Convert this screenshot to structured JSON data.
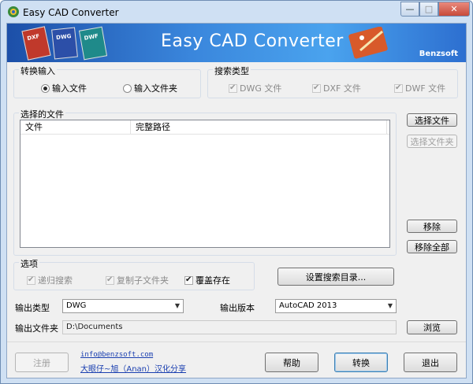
{
  "window": {
    "title": "Easy CAD Converter",
    "minimize": "—",
    "maximize": "□",
    "close": "✕",
    "close_color": "#c74a3a"
  },
  "banner": {
    "title": "Easy CAD Converter",
    "brand": "Benzsoft",
    "file_icons": [
      {
        "label": "DXF",
        "color": "#c0392b"
      },
      {
        "label": "DWG",
        "color": "#2c4fa8"
      },
      {
        "label": "DWF",
        "color": "#1f8a8a"
      }
    ]
  },
  "input_group": {
    "label": "转换输入",
    "options": [
      {
        "label": "输入文件",
        "selected": true
      },
      {
        "label": "输入文件夹",
        "selected": false
      }
    ]
  },
  "search_group": {
    "label": "搜索类型",
    "options": [
      {
        "label": "DWG 文件",
        "checked": true,
        "disabled": true
      },
      {
        "label": "DXF 文件",
        "checked": true,
        "disabled": true
      },
      {
        "label": "DWF 文件",
        "checked": true,
        "disabled": true
      }
    ]
  },
  "files_group": {
    "label": "选择的文件",
    "columns": [
      "文件",
      "完整路径"
    ]
  },
  "side_buttons": {
    "select_files": "选择文件",
    "select_folder": "选择文件夹",
    "remove": "移除",
    "remove_all": "移除全部"
  },
  "options_group": {
    "label": "选项",
    "options": [
      {
        "label": "递归搜索",
        "checked": true,
        "disabled": true
      },
      {
        "label": "复制子文件夹",
        "checked": true,
        "disabled": true
      },
      {
        "label": "覆盖存在",
        "checked": true,
        "disabled": false
      }
    ],
    "set_search_dir": "设置搜索目录..."
  },
  "output": {
    "type_label": "输出类型",
    "type_value": "DWG",
    "version_label": "输出版本",
    "version_value": "AutoCAD 2013",
    "folder_label": "输出文件夹",
    "folder_value": "D:\\Documents",
    "browse": "浏览"
  },
  "footer": {
    "register": "注册",
    "email": "info@benzsoft.com",
    "credit": "大眼仔~旭（Anan）汉化分享",
    "help": "帮助",
    "convert": "转换",
    "exit": "退出"
  }
}
